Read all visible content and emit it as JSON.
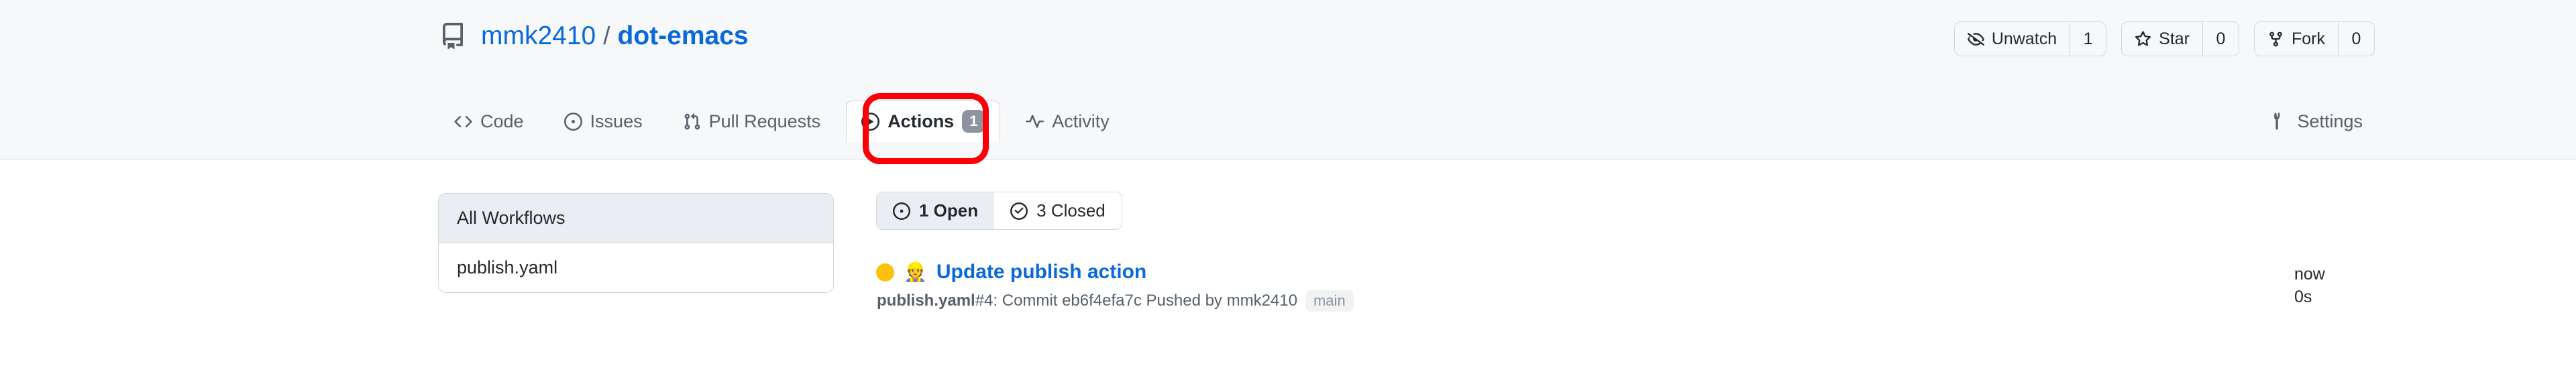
{
  "header": {
    "repo_icon": "repo-book-icon",
    "owner": "mmk2410",
    "separator": "/",
    "name": "dot-emacs",
    "actions": [
      {
        "icon": "eye-closed-icon",
        "label": "Unwatch",
        "count": "1"
      },
      {
        "icon": "star-icon",
        "label": "Star",
        "count": "0"
      },
      {
        "icon": "repo-forked-icon",
        "label": "Fork",
        "count": "0"
      }
    ]
  },
  "nav": {
    "items": [
      {
        "icon": "code-icon",
        "label": "Code",
        "selected": false
      },
      {
        "icon": "issue-opened-icon",
        "label": "Issues",
        "selected": false
      },
      {
        "icon": "git-pull-request-icon",
        "label": "Pull Requests",
        "selected": false
      },
      {
        "icon": "play-icon",
        "label": "Actions",
        "counter": "1",
        "selected": true
      },
      {
        "icon": "pulse-icon",
        "label": "Activity",
        "selected": false
      }
    ],
    "settings": {
      "icon": "gear-wrench-icon",
      "label": "Settings"
    }
  },
  "annotation": {
    "target": "actions-tab",
    "color": "#fb0007"
  },
  "sidebar": {
    "items": [
      {
        "label": "All Workflows",
        "active": true
      },
      {
        "label": "publish.yaml",
        "active": false
      }
    ]
  },
  "filters": [
    {
      "icon": "issue-opened-icon",
      "label": "1 Open",
      "active": true
    },
    {
      "icon": "check-circle-icon",
      "label": "3 Closed",
      "active": false
    }
  ],
  "runs": [
    {
      "status": "in_progress",
      "status_color": "#ffc107",
      "emoji": "👷",
      "title": "Update publish action",
      "workflow": "publish.yaml",
      "run_number": "#4",
      "meta_separator": ": ",
      "meta_detail": "Commit eb6f4efa7c Pushed by mmk2410",
      "branch": "main",
      "time": "now",
      "duration": "0s"
    }
  ]
}
